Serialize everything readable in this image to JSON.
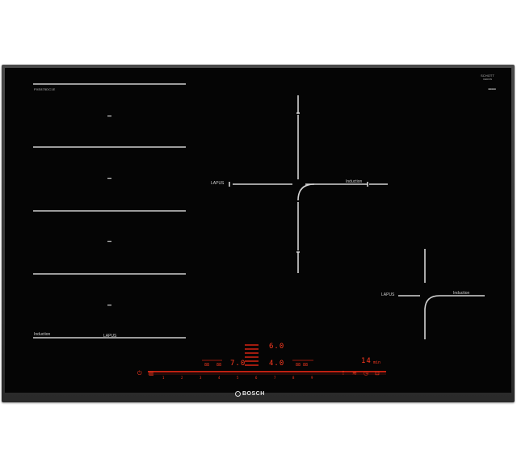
{
  "device": {
    "model_label": "PXE875DC1E",
    "schott_line1": "SCHOTT",
    "schott_line2": "CERAN",
    "serial_label": "■■■■■",
    "brand": "BOSCH"
  },
  "zones": {
    "left_bottom_label_left": "Induction",
    "left_bottom_label_right": "LAPUS"
  },
  "right_zones": {
    "large_left_label": "LAPUS",
    "large_right_label": "Induction",
    "small_left_label": "LAPUS",
    "small_right_label": "Induction"
  },
  "display": {
    "power_upper": "6.0",
    "power_lower": "4.0",
    "power_left": "7.0",
    "timer_value": "14",
    "timer_unit": "min",
    "left_small_a": "88",
    "left_small_b": "88",
    "right_small": "88 88"
  },
  "slider": {
    "numbers": [
      "1",
      "2",
      "3",
      "4",
      "5",
      "6",
      "7",
      "8",
      "9"
    ]
  },
  "colors": {
    "glass": "#050505",
    "frame": "#3a3a3a",
    "display_red": "#ff2b16",
    "marking": "#d8d8d8"
  }
}
